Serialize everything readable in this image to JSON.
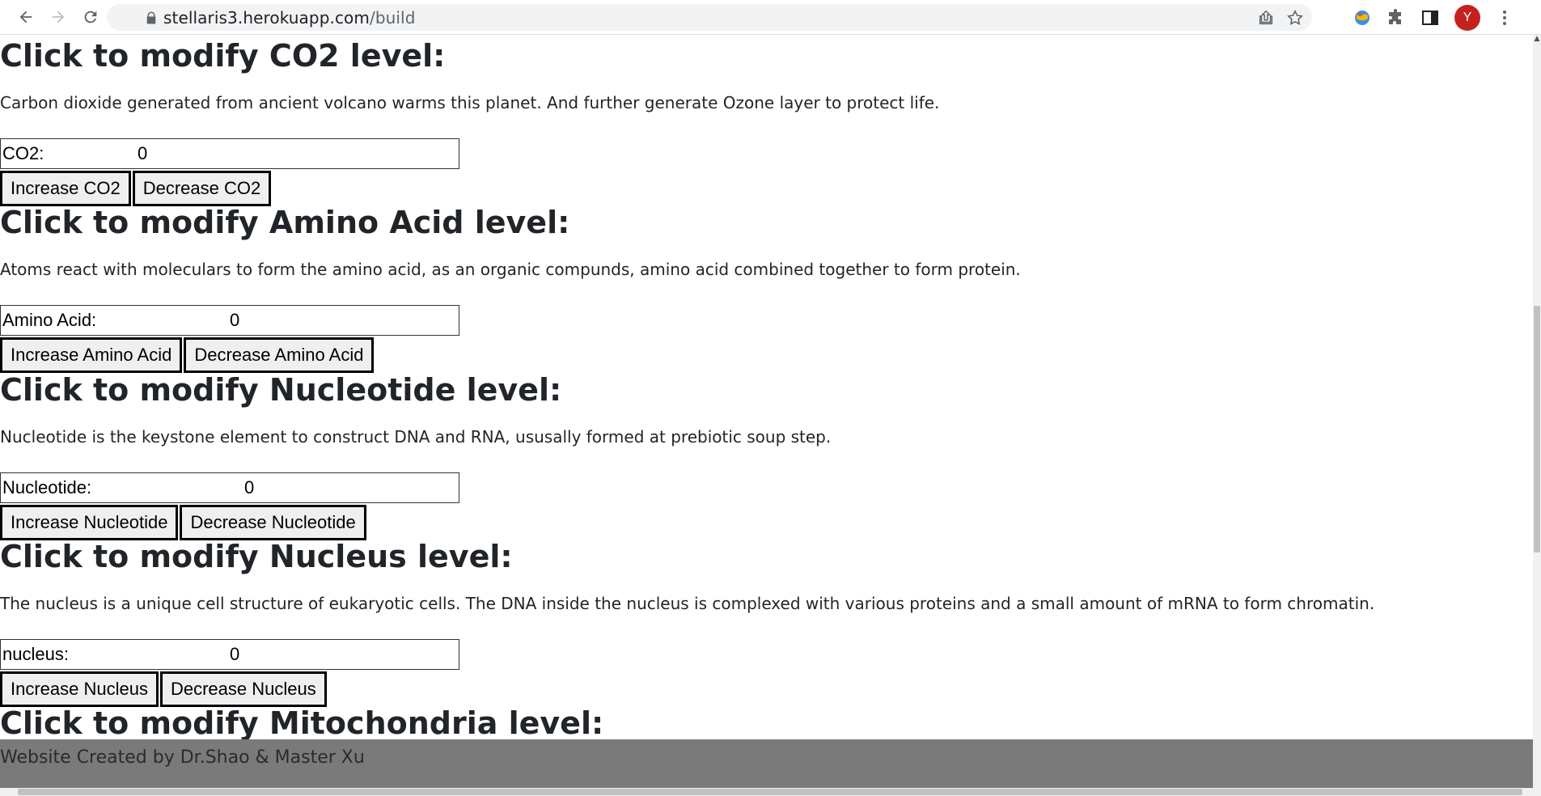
{
  "browser": {
    "url_host": "stellaris3.herokuapp.com",
    "url_path": "/build",
    "avatar_letter": "Y",
    "accent_avatar": "#c5221f"
  },
  "sections": [
    {
      "heading": "Click to modify CO2 level:",
      "description": "Carbon dioxide generated from ancient volcano warms this planet. And further generate Ozone layer to protect life.",
      "label": "CO2:",
      "value": "0",
      "increase_label": "Increase CO2",
      "decrease_label": "Decrease CO2"
    },
    {
      "heading": "Click to modify Amino Acid level:",
      "description": "Atoms react with moleculars to form the amino acid, as an organic compunds, amino acid combined together to form protein.",
      "label": "Amino Acid:",
      "value": "0",
      "increase_label": "Increase Amino Acid",
      "decrease_label": "Decrease Amino Acid"
    },
    {
      "heading": "Click to modify Nucleotide level:",
      "description": "Nucleotide is the keystone element to construct DNA and RNA, ususally formed at prebiotic soup step.",
      "label": "Nucleotide:",
      "value": "0",
      "increase_label": "Increase Nucleotide",
      "decrease_label": "Decrease Nucleotide"
    },
    {
      "heading": "Click to modify Nucleus level:",
      "description": "The nucleus is a unique cell structure of eukaryotic cells. The DNA inside the nucleus is complexed with various proteins and a small amount of mRNA to form chromatin.",
      "label": "nucleus:",
      "value": "0",
      "increase_label": "Increase Nucleus",
      "decrease_label": "Decrease Nucleus"
    },
    {
      "heading": "Click to modify Mitochondria level:"
    }
  ],
  "footer": {
    "text": "Website Created by Dr.Shao & Master Xu",
    "background": "#7a7a7a"
  }
}
